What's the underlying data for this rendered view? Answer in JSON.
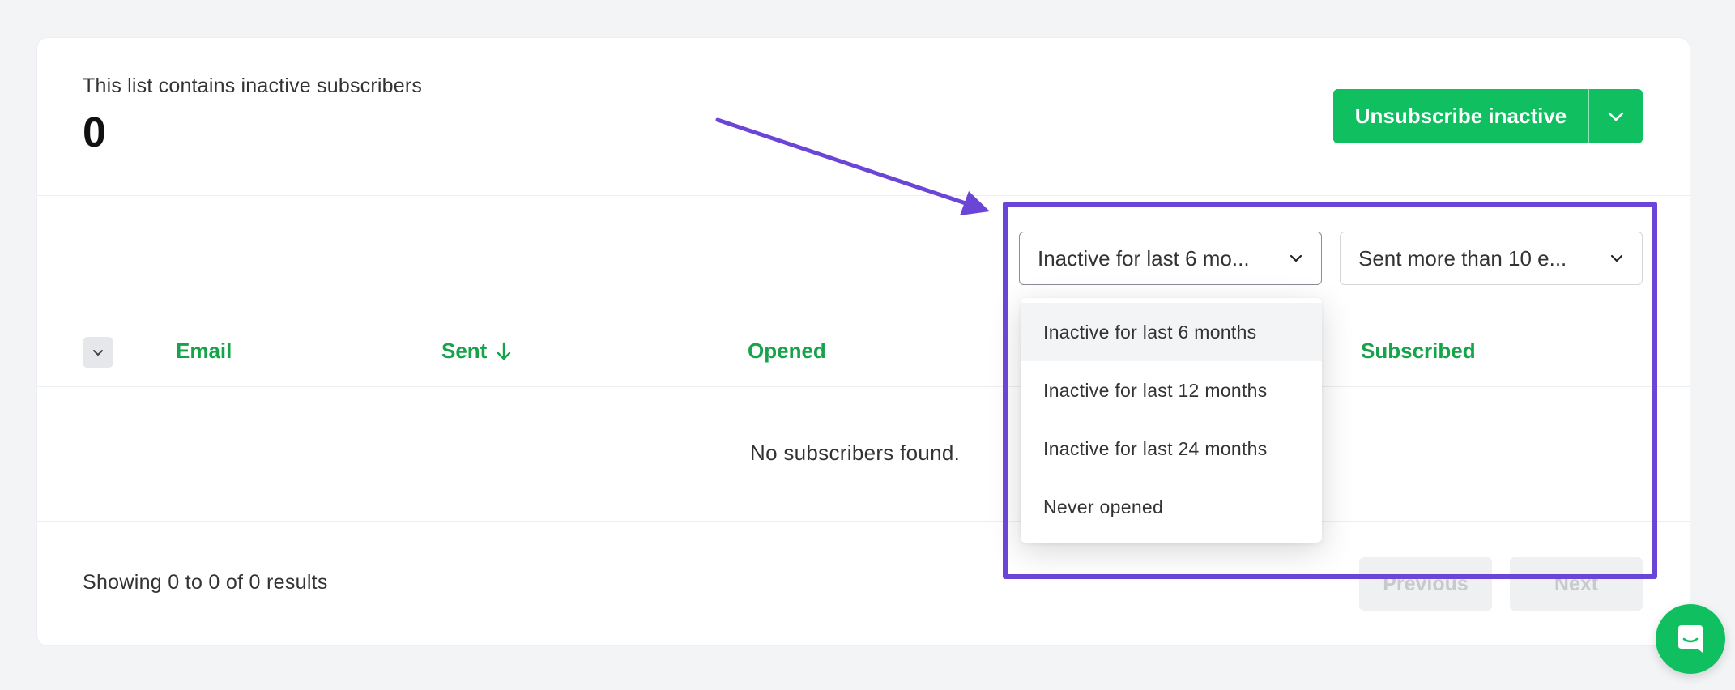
{
  "summary": {
    "label": "This list contains inactive subscribers",
    "count": "0"
  },
  "actions": {
    "unsubscribe_label": "Unsubscribe inactive"
  },
  "filters": {
    "inactivity": "Inactive for last 6 mo...",
    "sent": "Sent more than 10 e..."
  },
  "table": {
    "columns": [
      "Email",
      "Sent",
      "Opened",
      "Subscribed"
    ],
    "empty_message": "No subscribers found."
  },
  "footer": {
    "results_text": "Showing 0 to 0 of 0 results",
    "previous_label": "Previous",
    "next_label": "Next"
  },
  "dropdown": {
    "options": [
      "Inactive for last 6 months",
      "Inactive for last 12 months",
      "Inactive for last 24 months",
      "Never opened"
    ],
    "highlighted_index": 0
  },
  "icons": {
    "unsubscribe_caret": "chevron-down-icon",
    "filter_caret": "chevron-down-icon",
    "sort": "arrow-down-icon",
    "chat": "chat-bubble-icon"
  },
  "colors": {
    "primary": "#0fbf60",
    "header_text": "#16a34a",
    "annotation": "#6b46d6",
    "background": "#f3f4f6"
  }
}
